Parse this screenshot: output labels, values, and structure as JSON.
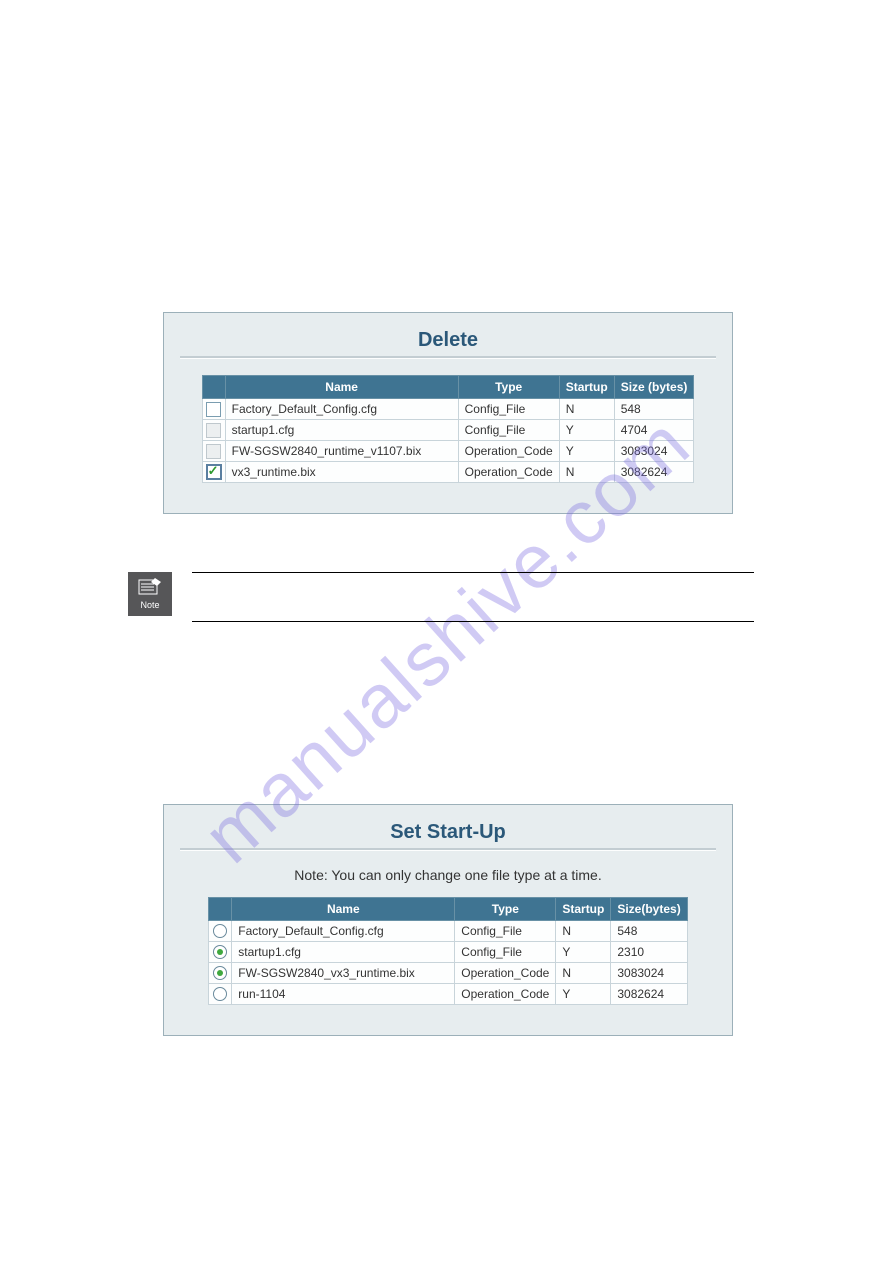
{
  "watermark": "manualshive.com",
  "delete_panel": {
    "title": "Delete",
    "headers": {
      "name": "Name",
      "type": "Type",
      "startup": "Startup",
      "size": "Size (bytes)"
    },
    "rows": [
      {
        "checked": false,
        "cb_class": "cb",
        "name": "Factory_Default_Config.cfg",
        "type": "Config_File",
        "startup": "N",
        "size": "548"
      },
      {
        "checked": false,
        "cb_class": "cb gray",
        "name": "startup1.cfg",
        "type": "Config_File",
        "startup": "Y",
        "size": "4704"
      },
      {
        "checked": false,
        "cb_class": "cb gray",
        "name": "FW-SGSW2840_runtime_v1107.bix",
        "type": "Operation_Code",
        "startup": "Y",
        "size": "3083024"
      },
      {
        "checked": true,
        "cb_class": "cb checked",
        "name": "vx3_runtime.bix",
        "type": "Operation_Code",
        "startup": "N",
        "size": "3082624"
      }
    ]
  },
  "note_icon_label": "Note",
  "startup_panel": {
    "title": "Set Start-Up",
    "subnote": "Note: You can only change one file type at a time.",
    "headers": {
      "name": "Name",
      "type": "Type",
      "startup": "Startup",
      "size": "Size(bytes)"
    },
    "rows": [
      {
        "checked": false,
        "rb_class": "rb",
        "name": "Factory_Default_Config.cfg",
        "type": "Config_File",
        "startup": "N",
        "size": "548"
      },
      {
        "checked": true,
        "rb_class": "rb checked",
        "name": "startup1.cfg",
        "type": "Config_File",
        "startup": "Y",
        "size": "2310"
      },
      {
        "checked": true,
        "rb_class": "rb checked",
        "name": "FW-SGSW2840_vx3_runtime.bix",
        "type": "Operation_Code",
        "startup": "N",
        "size": "3083024"
      },
      {
        "checked": false,
        "rb_class": "rb",
        "name": "run-1104",
        "type": "Operation_Code",
        "startup": "Y",
        "size": "3082624"
      }
    ]
  }
}
